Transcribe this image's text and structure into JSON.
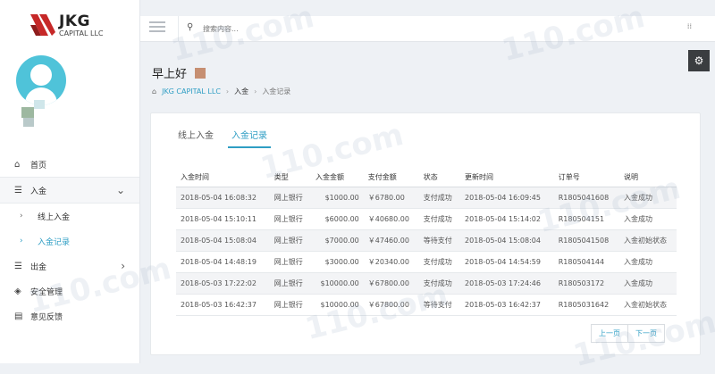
{
  "brand": {
    "name": "JKG",
    "sub": "CAPITAL LLC",
    "accent": "#c62828"
  },
  "sidebar": {
    "items": [
      {
        "icon": "home-icon",
        "label": "首页"
      },
      {
        "icon": "list-icon",
        "label": "入金",
        "expanded": true,
        "children": [
          {
            "label": "线上入金"
          },
          {
            "label": "入金记录",
            "current": true
          }
        ]
      },
      {
        "icon": "list-icon",
        "label": "出金"
      },
      {
        "icon": "shield-icon",
        "label": "安全管理"
      },
      {
        "icon": "file-icon",
        "label": "意见反馈"
      }
    ]
  },
  "search": {
    "placeholder": "搜索内容..."
  },
  "header": {
    "greeting": "早上好"
  },
  "breadcrumb": {
    "company": "JKG CAPITAL LLC",
    "section": "入金",
    "page": "入金记录"
  },
  "tabs": [
    {
      "label": "线上入金"
    },
    {
      "label": "入金记录",
      "active": true
    }
  ],
  "table": {
    "headers": [
      "入金时间",
      "类型",
      "入金金额",
      "支付金额",
      "状态",
      "更新时间",
      "订单号",
      "说明"
    ],
    "rows": [
      {
        "time": "2018-05-04 16:08:32",
        "type": "网上银行",
        "amount": "$1000.00",
        "paid": "￥6780.00",
        "status": "支付成功",
        "status_kind": "ok",
        "updated": "2018-05-04 16:09:45",
        "order": "R1805041608",
        "note": "入金成功",
        "note_kind": "ok"
      },
      {
        "time": "2018-05-04 15:10:11",
        "type": "网上银行",
        "amount": "$6000.00",
        "paid": "￥40680.00",
        "status": "支付成功",
        "status_kind": "ok",
        "updated": "2018-05-04 15:14:02",
        "order": "R180504151",
        "note": "入金成功",
        "note_kind": "ok"
      },
      {
        "time": "2018-05-04 15:08:04",
        "type": "网上银行",
        "amount": "$7000.00",
        "paid": "￥47460.00",
        "status": "等待支付",
        "status_kind": "wait",
        "updated": "2018-05-04 15:08:04",
        "order": "R1805041508",
        "note": "入金初始状态",
        "note_kind": "init"
      },
      {
        "time": "2018-05-04 14:48:19",
        "type": "网上银行",
        "amount": "$3000.00",
        "paid": "￥20340.00",
        "status": "支付成功",
        "status_kind": "ok",
        "updated": "2018-05-04 14:54:59",
        "order": "R180504144",
        "note": "入金成功",
        "note_kind": "ok"
      },
      {
        "time": "2018-05-03 17:22:02",
        "type": "网上银行",
        "amount": "$10000.00",
        "paid": "￥67800.00",
        "status": "支付成功",
        "status_kind": "ok",
        "updated": "2018-05-03 17:24:46",
        "order": "R180503172",
        "note": "入金成功",
        "note_kind": "ok"
      },
      {
        "time": "2018-05-03 16:42:37",
        "type": "网上银行",
        "amount": "$10000.00",
        "paid": "￥67800.00",
        "status": "等待支付",
        "status_kind": "wait",
        "updated": "2018-05-03 16:42:37",
        "order": "R1805031642",
        "note": "入金初始状态",
        "note_kind": "init"
      }
    ]
  },
  "pager": {
    "prev": "上一页",
    "next": "下一页"
  },
  "watermark": "110.com",
  "colors": {
    "link": "#2f9ec4",
    "success": "#3a8f2a",
    "pending": "#d08a18",
    "amount": "#c43a3a"
  }
}
